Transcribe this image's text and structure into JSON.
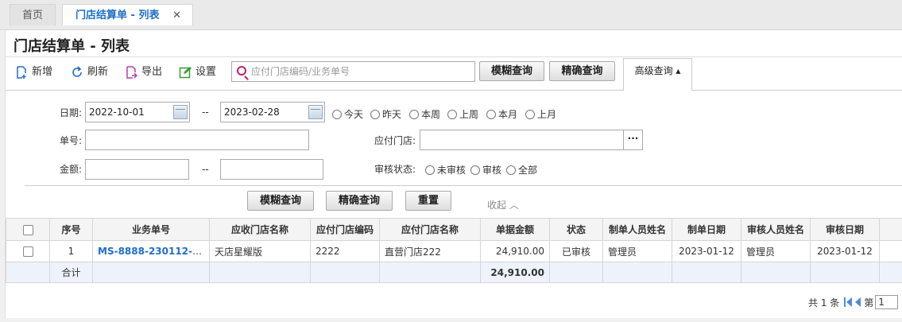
{
  "tabs": {
    "home": "首页",
    "active": "门店结算单 - 列表",
    "close": "✕"
  },
  "page_title": "门店结算单 - 列表",
  "toolbar": {
    "add": "新增",
    "refresh": "刷新",
    "export": "导出",
    "settings": "设置",
    "search_placeholder": "应付门店编码/业务单号",
    "fuzzy": "模糊查询",
    "exact": "精确查询",
    "advanced": "高级查询"
  },
  "filters": {
    "date_label": "日期:",
    "date_from": "2022-10-01",
    "date_sep": "--",
    "date_to": "2023-02-28",
    "ranges": [
      "今天",
      "昨天",
      "本周",
      "上周",
      "本月",
      "上月"
    ],
    "order_label": "单号:",
    "store_label": "应付门店:",
    "amount_label": "金额:",
    "amount_sep": "--",
    "audit_label": "审核状态:",
    "audit_options": [
      "未审核",
      "审核",
      "全部"
    ],
    "fuzzy": "模糊查询",
    "exact": "精确查询",
    "reset": "重置",
    "collapse": "收起 ︿"
  },
  "table": {
    "headers": [
      "序号",
      "业务单号",
      "应收门店名称",
      "应付门店编码",
      "应付门店名称",
      "单据金额",
      "状态",
      "制单人员姓名",
      "制单日期",
      "审核人员姓名",
      "审核日期"
    ],
    "rows": [
      {
        "no": "1",
        "order": "MS-8888-230112-00...",
        "recv_store": "天店星耀版",
        "pay_code": "2222",
        "pay_store": "直营门店222",
        "amount": "24,910.00",
        "status": "已审核",
        "creator": "管理员",
        "create_date": "2023-01-12",
        "auditor": "管理员",
        "audit_date": "2023-01-12"
      }
    ],
    "total_label": "合计",
    "total_amount": "24,910.00"
  },
  "pager": {
    "summary": "共 1 条",
    "page_label": "第",
    "page": "1"
  },
  "colors": {
    "accent": "#1e6ec8",
    "search_icon": "#c0236b"
  }
}
